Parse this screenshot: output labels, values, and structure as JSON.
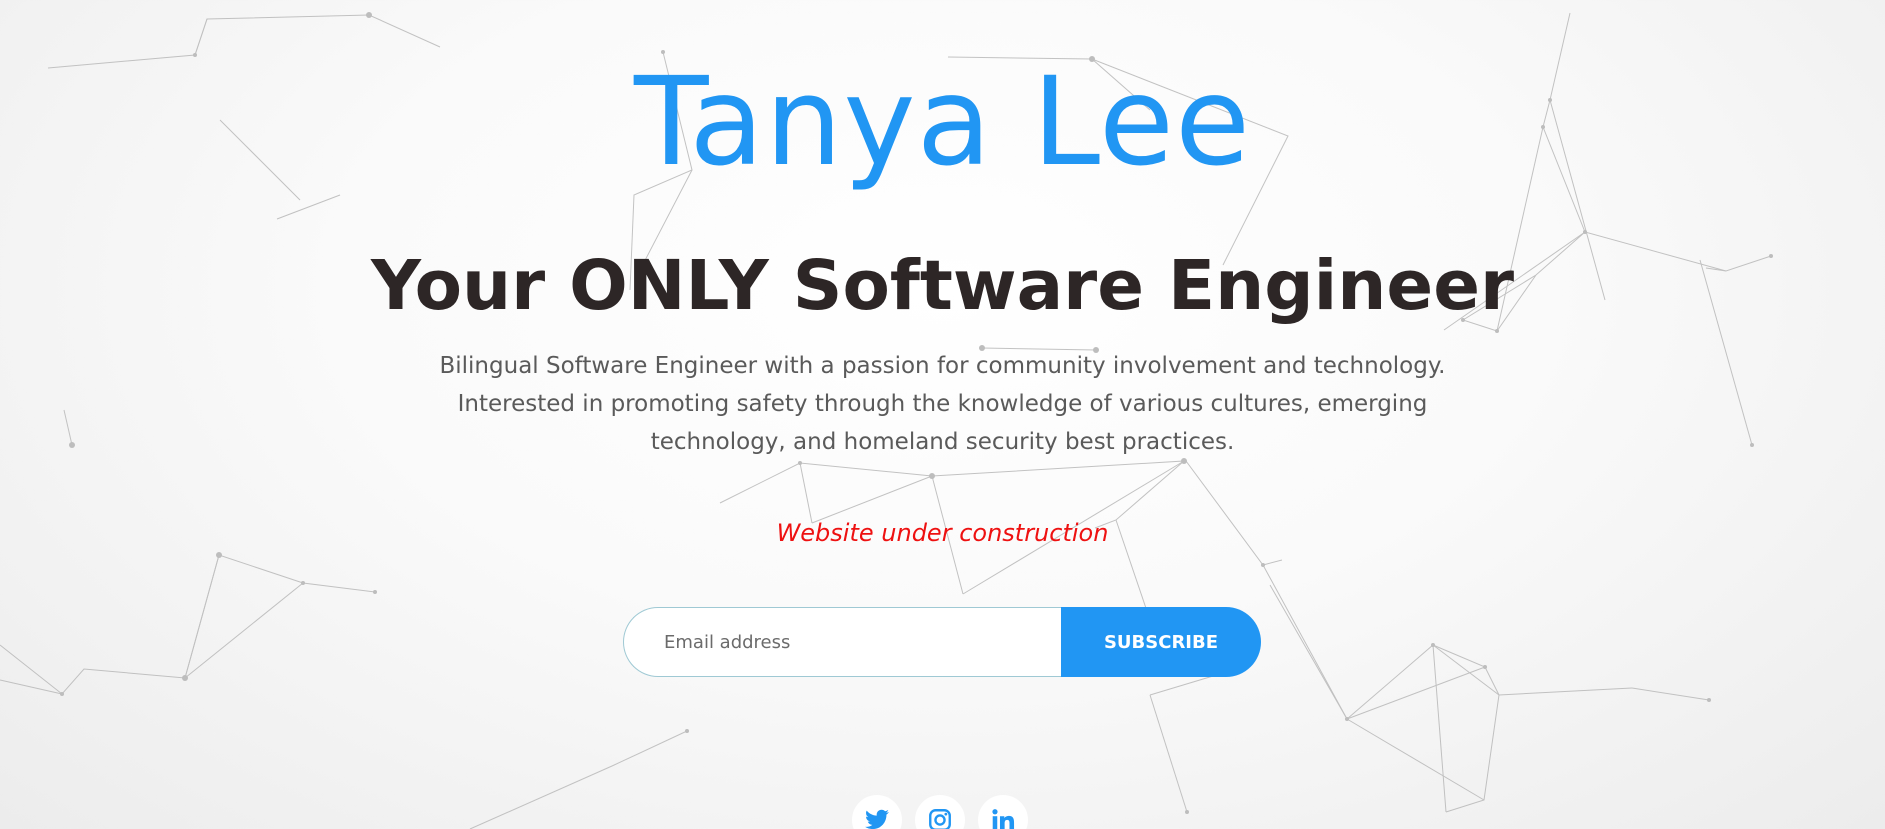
{
  "colors": {
    "accent": "#2196f3",
    "heading": "#2d2626",
    "body_text": "#5a5a5a",
    "notice": "#ee1111",
    "background": "#f5f5f5"
  },
  "hero": {
    "name": "Tanya Lee",
    "tagline": "Your ONLY Software Engineer",
    "bio": "Bilingual Software Engineer with a passion for community involvement and technology. Interested in promoting safety through the knowledge of various cultures, emerging technology, and homeland security best practices.",
    "notice": "Website under construction"
  },
  "subscribe": {
    "email_placeholder": "Email address",
    "email_value": "",
    "button_label": "SUBSCRIBE"
  },
  "social": [
    {
      "icon": "twitter-icon"
    },
    {
      "icon": "instagram-icon"
    },
    {
      "icon": "linkedin-icon"
    }
  ]
}
